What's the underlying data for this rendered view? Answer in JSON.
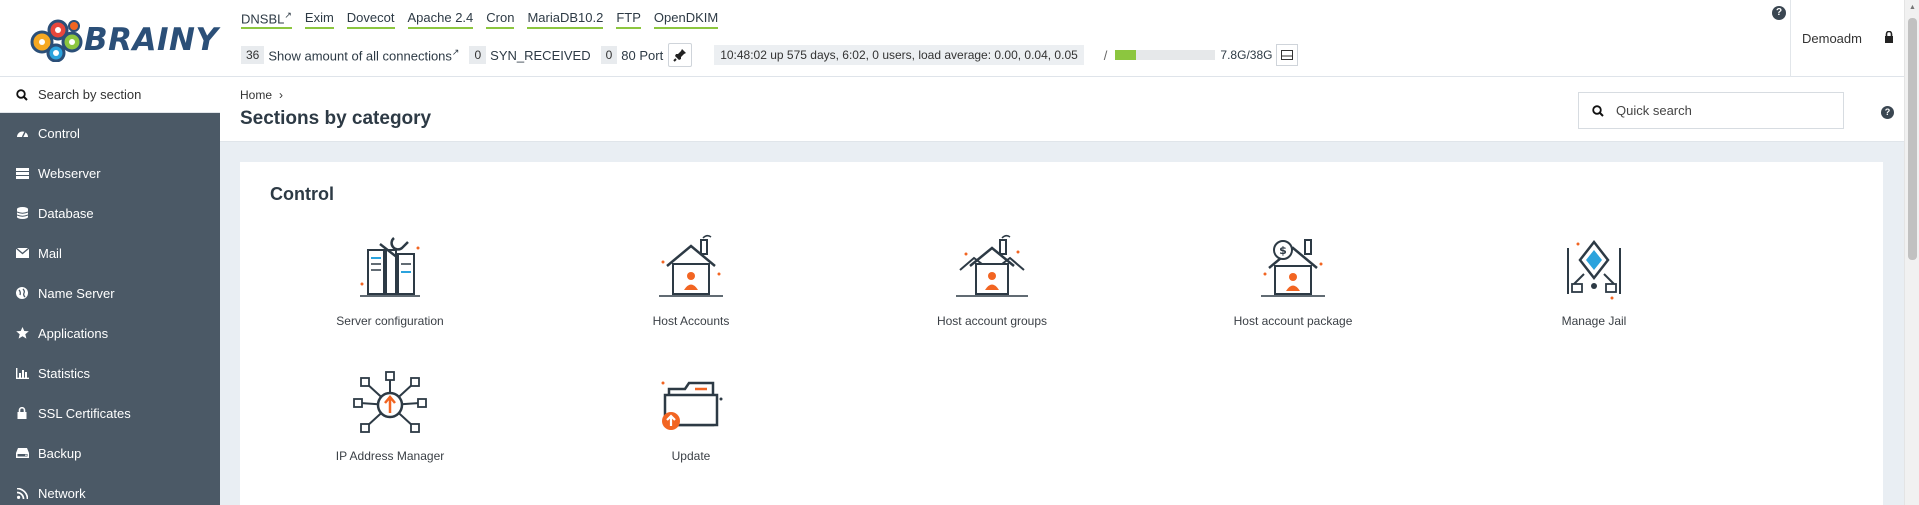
{
  "brand": {
    "name": "BRAINY"
  },
  "services": [
    {
      "label": "DNSBL",
      "external": true
    },
    {
      "label": "Exim",
      "external": false
    },
    {
      "label": "Dovecot",
      "external": false
    },
    {
      "label": "Apache 2.4",
      "external": false
    },
    {
      "label": "Cron",
      "external": false
    },
    {
      "label": "MariaDB10.2",
      "external": false
    },
    {
      "label": "FTP",
      "external": false
    },
    {
      "label": "OpenDKIM",
      "external": false
    }
  ],
  "status": {
    "connections_count": "36",
    "connections_label": "Show amount of all connections",
    "syn_count": "0",
    "syn_label": "SYN_RECEIVED",
    "port_count": "0",
    "port_label": "80 Port",
    "uptime": "10:48:02 up 575 days, 6:02, 0 users, load average: 0.00, 0.04, 0.05",
    "disk_mount": "/",
    "disk_usage": "7.8G/38G",
    "disk_fraction": 0.205
  },
  "help_symbol": "?",
  "user": {
    "name": "Demoadm"
  },
  "sidebar": {
    "search_placeholder": "Search by section",
    "items": [
      {
        "label": "Control",
        "icon": "dashboard-icon"
      },
      {
        "label": "Webserver",
        "icon": "server-icon"
      },
      {
        "label": "Database",
        "icon": "database-icon"
      },
      {
        "label": "Mail",
        "icon": "envelope-icon"
      },
      {
        "label": "Name Server",
        "icon": "globe-icon"
      },
      {
        "label": "Applications",
        "icon": "star-icon"
      },
      {
        "label": "Statistics",
        "icon": "bar-chart-icon"
      },
      {
        "label": "SSL Certificates",
        "icon": "lock-icon"
      },
      {
        "label": "Backup",
        "icon": "hard-drive-icon"
      },
      {
        "label": "Network",
        "icon": "rss-icon"
      }
    ]
  },
  "breadcrumb": {
    "home": "Home",
    "separator": "›"
  },
  "page": {
    "title": "Sections by category"
  },
  "quick_search": {
    "placeholder": "Quick search"
  },
  "panel": {
    "title": "Control",
    "tiles": [
      {
        "label": "Server configuration",
        "icon": "server-configuration-icon"
      },
      {
        "label": "Host Accounts",
        "icon": "host-accounts-icon"
      },
      {
        "label": "Host account groups",
        "icon": "host-account-groups-icon"
      },
      {
        "label": "Host account package",
        "icon": "host-account-package-icon"
      },
      {
        "label": "Manage Jail",
        "icon": "manage-jail-icon"
      },
      {
        "label": "IP Address Manager",
        "icon": "ip-address-manager-icon"
      },
      {
        "label": "Update",
        "icon": "update-icon"
      }
    ]
  },
  "colors": {
    "accent_green": "#8cc63f",
    "orange": "#f26522",
    "sidebar_bg": "#4b5966",
    "navy": "#2b4f78"
  }
}
